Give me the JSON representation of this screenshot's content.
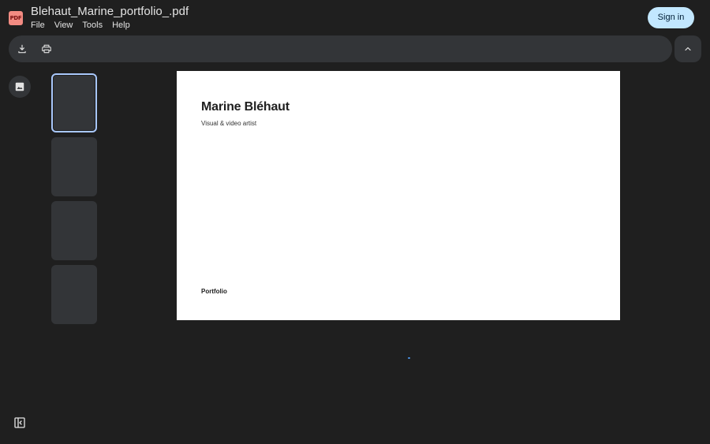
{
  "header": {
    "logo_text": "PDF",
    "title": "Blehaut_Marine_portfolio_.pdf",
    "menu": [
      "File",
      "View",
      "Tools",
      "Help"
    ],
    "signin_label": "Sign in"
  },
  "toolbar": {
    "download_icon": "download-icon",
    "print_icon": "print-icon",
    "collapse_icon": "chevron-up-icon"
  },
  "sidebar": {
    "image_icon": "image-icon",
    "toggle_icon": "side-panel-icon",
    "thumbnail_count": 4,
    "selected_thumbnail": 1
  },
  "page": {
    "name": "Marine Bléhaut",
    "subtitle": "Visual & video artist",
    "footer": "Portfolio"
  },
  "colors": {
    "background": "#1f1f1f",
    "surface": "#333538",
    "accent": "#c2e7ff",
    "selection": "#a8c7fa",
    "logo": "#f28b82"
  }
}
